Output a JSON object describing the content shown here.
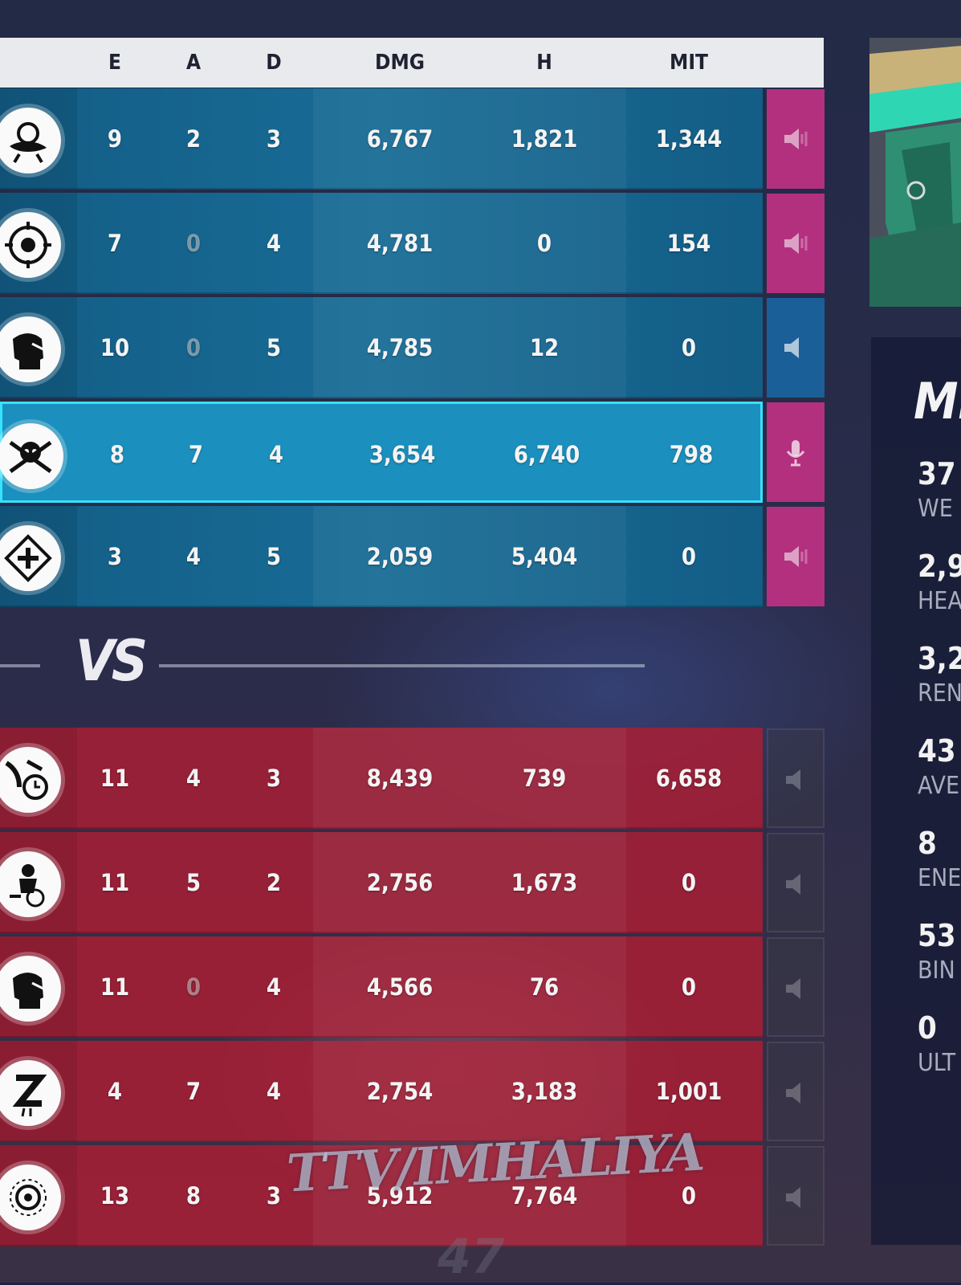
{
  "columns": [
    "E",
    "A",
    "D",
    "DMG",
    "H",
    "MIT"
  ],
  "vs_label": "VS",
  "team_allies": [
    {
      "hero_icon": "rose-emblem-icon",
      "e": "9",
      "a": "2",
      "d": "3",
      "dmg": "6,767",
      "h": "1,821",
      "mit": "1,344",
      "voice": "speaker-pink"
    },
    {
      "hero_icon": "target-emblem-icon",
      "e": "7",
      "a": "0",
      "d": "4",
      "dmg": "4,781",
      "h": "0",
      "mit": "154",
      "voice": "speaker-pink"
    },
    {
      "hero_icon": "fist-emblem-icon",
      "e": "10",
      "a": "0",
      "d": "5",
      "dmg": "4,785",
      "h": "12",
      "mit": "0",
      "voice": "speaker-blue"
    },
    {
      "hero_icon": "skull-crossbones-icon",
      "e": "8",
      "a": "7",
      "d": "4",
      "dmg": "3,654",
      "h": "6,740",
      "mit": "798",
      "voice": "microphone-pink",
      "self": true
    },
    {
      "hero_icon": "diamond-cross-icon",
      "e": "3",
      "a": "4",
      "d": "5",
      "dmg": "2,059",
      "h": "5,404",
      "mit": "0",
      "voice": "speaker-pink"
    }
  ],
  "team_enemies": [
    {
      "hero_icon": "clock-dash-icon",
      "e": "11",
      "a": "4",
      "d": "3",
      "dmg": "8,439",
      "h": "739",
      "mit": "6,658"
    },
    {
      "hero_icon": "rider-clock-icon",
      "e": "11",
      "a": "5",
      "d": "2",
      "dmg": "2,756",
      "h": "1,673",
      "mit": "0"
    },
    {
      "hero_icon": "fist-emblem-icon",
      "e": "11",
      "a": "0",
      "d": "4",
      "dmg": "4,566",
      "h": "76",
      "mit": "0"
    },
    {
      "hero_icon": "z-sleep-icon",
      "e": "4",
      "a": "7",
      "d": "4",
      "dmg": "2,754",
      "h": "3,183",
      "mit": "1,001"
    },
    {
      "hero_icon": "gear-sun-icon",
      "e": "13",
      "a": "8",
      "d": "3",
      "dmg": "5,912",
      "h": "7,764",
      "mit": "0"
    }
  ],
  "hero_panel": {
    "name": "MIZ",
    "stats": [
      {
        "value": "37",
        "label": "WE"
      },
      {
        "value": "2,9",
        "label": "HEA"
      },
      {
        "value": "3,2",
        "label": "REN"
      },
      {
        "value": "43",
        "label": "AVE"
      },
      {
        "value": "8",
        "label": "ENE"
      },
      {
        "value": "53",
        "label": "BIN"
      },
      {
        "value": "0",
        "label": "ULT"
      }
    ]
  },
  "watermark": "TTV/IMHALIYA",
  "colors": {
    "ally_row": "#186c96",
    "self_row": "#1b8fbd",
    "self_border": "#36e3ff",
    "enemy_row": "#a81e34",
    "voice_pink": "#b3307f",
    "voice_blue": "#1a5f98",
    "header_bg": "#e9eaee"
  }
}
